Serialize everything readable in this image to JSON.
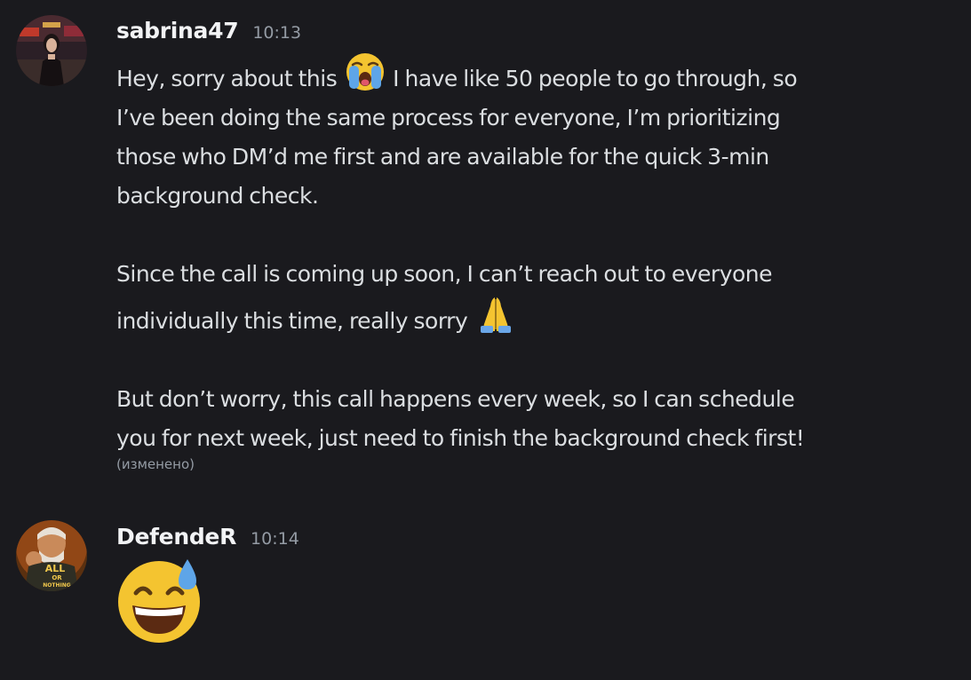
{
  "messages": [
    {
      "username": "sabrina47",
      "time": "10:13",
      "paragraphs": {
        "p1_before": "Hey, sorry about this",
        "p1_emoji": "loudly-crying-face",
        "p1_line1_after": "I have like 50 people to go through, so",
        "p1_line2": "I’ve been doing the same process for everyone, I’m prioritizing",
        "p1_line3": "those who DM’d me first and are available for the quick 3-min",
        "p1_line4": "background check.",
        "p2_line1": "Since the call is coming up soon, I can’t reach out to everyone",
        "p2_line2": "individually this time, really sorry",
        "p2_emoji": "folded-hands",
        "p3_line1": "But don’t worry, this call happens every week, so I can schedule",
        "p3_line2": "you for next week, just need to finish the background check first!"
      },
      "edited": "(изменено)"
    },
    {
      "username": "DefendeR",
      "time": "10:14",
      "emoji": "grinning-face-with-sweat",
      "avatar_text": {
        "line1": "ALL",
        "line2": "OR",
        "line3": "NOTHING"
      }
    }
  ],
  "colors": {
    "background": "#1a1a1e",
    "text": "#dbdee1",
    "username": "#f2f3f5",
    "muted": "#949ba4"
  }
}
